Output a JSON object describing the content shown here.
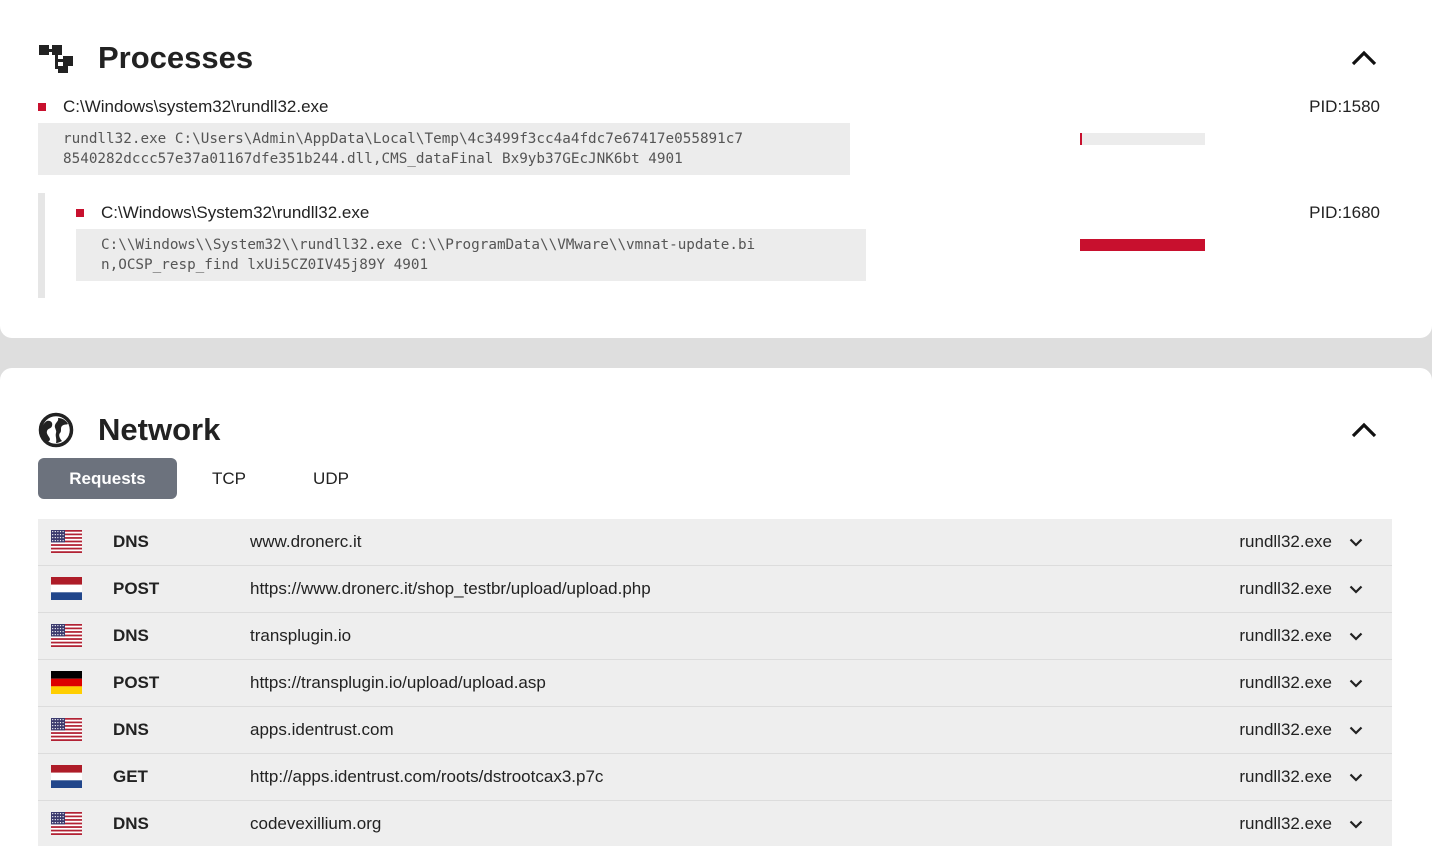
{
  "processes": {
    "title": "Processes",
    "icon": "process-tree-icon",
    "items": [
      {
        "path": "C:\\Windows\\system32\\rundll32.exe",
        "pid": "PID:1580",
        "cmd_line1": "rundll32.exe C:\\Users\\Admin\\AppData\\Local\\Temp\\4c3499f3cc4a4fdc7e67417e055891c7",
        "cmd_line2": "8540282dccc57e37a01167dfe351b244.dll,CMS_dataFinal Bx9yb37GEcJNK6bt 4901",
        "activity_fraction": 0.01
      },
      {
        "path": "C:\\Windows\\System32\\rundll32.exe",
        "pid": "PID:1680",
        "cmd_line1": "C:\\\\Windows\\\\System32\\\\rundll32.exe C:\\\\ProgramData\\\\VMware\\\\vmnat-update.bi",
        "cmd_line2": "n,OCSP_resp_find lxUi5CZ0IV45j89Y 4901",
        "activity_fraction": 1.0
      }
    ]
  },
  "network": {
    "title": "Network",
    "icon": "globe-icon",
    "tabs": [
      {
        "label": "Requests",
        "active": true
      },
      {
        "label": "TCP",
        "active": false
      },
      {
        "label": "UDP",
        "active": false
      }
    ],
    "requests": [
      {
        "flag": "us",
        "method": "DNS",
        "url": "www.dronerc.it",
        "process": "rundll32.exe"
      },
      {
        "flag": "nl",
        "method": "POST",
        "url": "https://www.dronerc.it/shop_testbr/upload/upload.php",
        "process": "rundll32.exe"
      },
      {
        "flag": "us",
        "method": "DNS",
        "url": "transplugin.io",
        "process": "rundll32.exe"
      },
      {
        "flag": "de",
        "method": "POST",
        "url": "https://transplugin.io/upload/upload.asp",
        "process": "rundll32.exe"
      },
      {
        "flag": "us",
        "method": "DNS",
        "url": "apps.identrust.com",
        "process": "rundll32.exe"
      },
      {
        "flag": "nl",
        "method": "GET",
        "url": "http://apps.identrust.com/roots/dstrootcax3.p7c",
        "process": "rundll32.exe"
      },
      {
        "flag": "us",
        "method": "DNS",
        "url": "codevexillium.org",
        "process": "rundll32.exe"
      }
    ]
  },
  "colors": {
    "accent": "#c8102e",
    "tab_active": "#6c727d",
    "row_bg": "#eeeeee"
  }
}
